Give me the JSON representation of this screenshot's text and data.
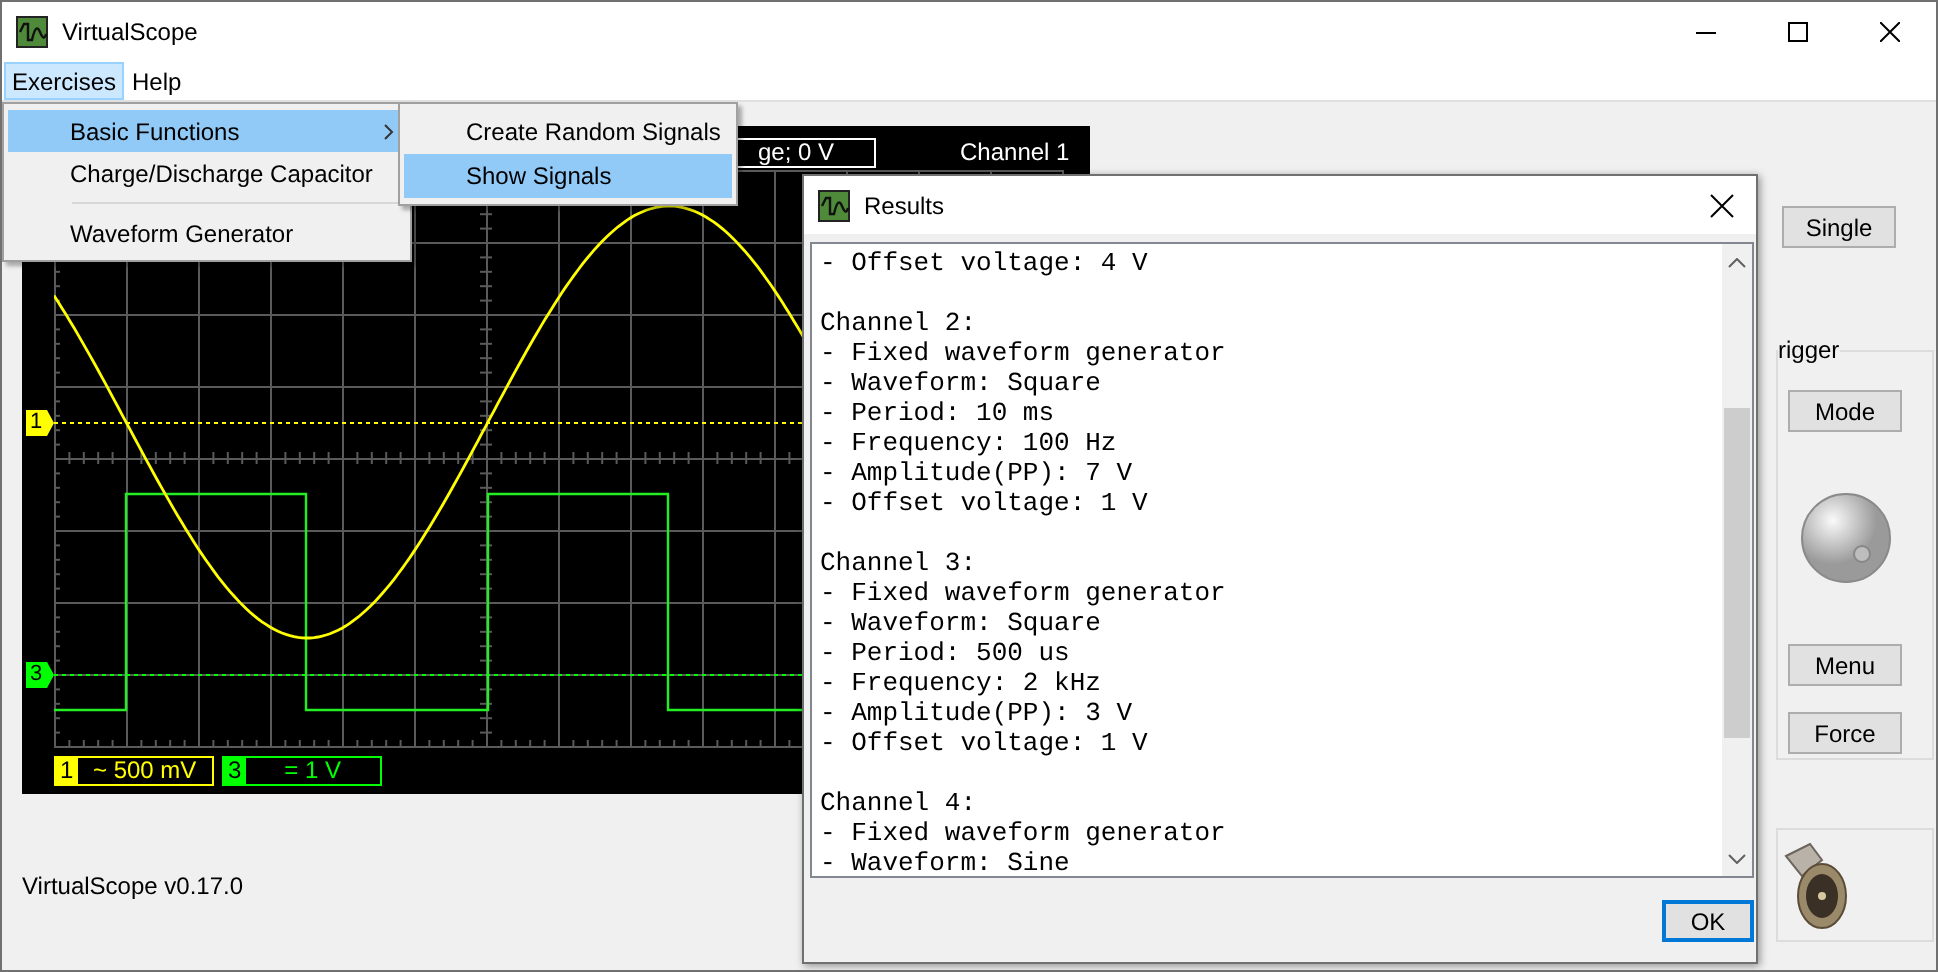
{
  "window": {
    "title": "VirtualScope"
  },
  "menu_bar": [
    {
      "label": "Exercises",
      "selected": true
    },
    {
      "label": "Help",
      "selected": false
    }
  ],
  "exercises_menu": {
    "items": [
      {
        "label": "Basic Functions",
        "kind": "submenu",
        "selected": true
      },
      {
        "label": "Charge/Discharge Capacitor",
        "kind": "item",
        "selected": false
      },
      {
        "kind": "separator"
      },
      {
        "label": "Waveform Generator",
        "kind": "item",
        "selected": false
      }
    ],
    "submenu": [
      {
        "label": "Create Random Signals",
        "selected": false
      },
      {
        "label": "Show Signals",
        "selected": true
      }
    ]
  },
  "scope": {
    "trigger_readout": "ge; 0 V",
    "trigger_source": "Channel 1",
    "channel_markers": [
      {
        "label": "1",
        "color": "#ffff00"
      },
      {
        "label": "3",
        "color": "#00ff00"
      }
    ],
    "channel_scales": [
      {
        "channel": "1",
        "scale": "~ 500 mV",
        "color": "#ffff00"
      },
      {
        "channel": "3",
        "scale": "= 1 V",
        "color": "#00ff00"
      }
    ]
  },
  "version": "VirtualScope v0.17.0",
  "controls": {
    "trigger_group_label": "rigger",
    "buttons": [
      "Single",
      "Mode",
      "Menu",
      "Force"
    ]
  },
  "results_dialog": {
    "title": "Results",
    "blocks": [
      {
        "lines": [
          "- Offset voltage: 4 V"
        ]
      },
      {
        "heading": "Channel 2:",
        "lines": [
          "- Fixed waveform generator",
          "- Waveform: Square",
          "- Period: 10 ms",
          "- Frequency: 100 Hz",
          "- Amplitude(PP): 7 V",
          "- Offset voltage: 1 V"
        ]
      },
      {
        "heading": "Channel 3:",
        "lines": [
          "- Fixed waveform generator",
          "- Waveform: Square",
          "- Period: 500 us",
          "- Frequency: 2 kHz",
          "- Amplitude(PP): 3 V",
          "- Offset voltage: 1 V"
        ]
      },
      {
        "heading": "Channel 4:",
        "lines": [
          "- Fixed waveform generator",
          "- Waveform: Sine"
        ]
      }
    ],
    "ok_button": "OK"
  }
}
